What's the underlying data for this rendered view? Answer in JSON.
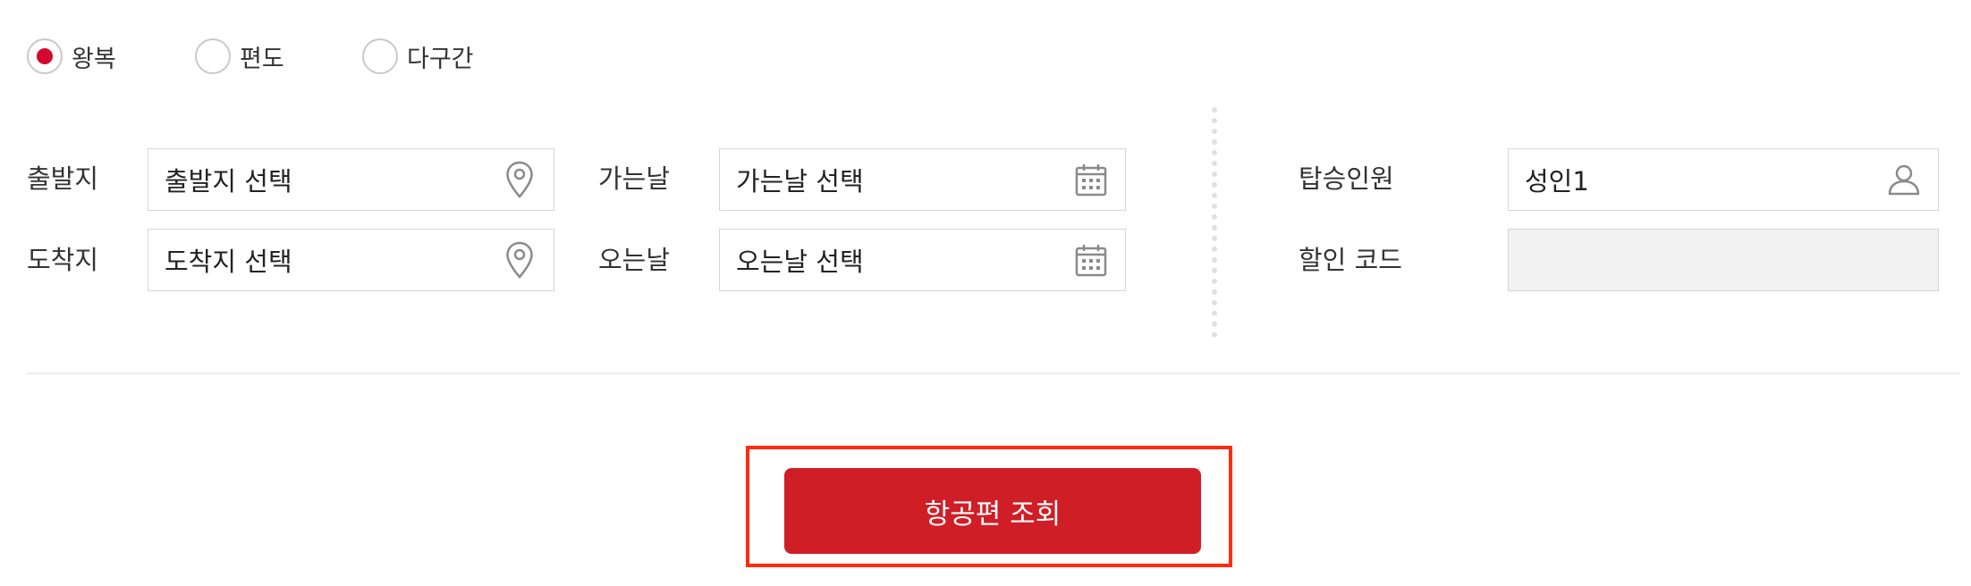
{
  "trip_type": {
    "options": [
      {
        "label": "왕복",
        "selected": true
      },
      {
        "label": "편도",
        "selected": false
      },
      {
        "label": "다구간",
        "selected": false
      }
    ]
  },
  "departure": {
    "label": "출발지",
    "value": "출발지 선택",
    "icon": "map-pin-icon"
  },
  "arrival": {
    "label": "도착지",
    "value": "도착지 선택",
    "icon": "map-pin-icon"
  },
  "depart_date": {
    "label": "가는날",
    "value": "가는날 선택",
    "icon": "calendar-icon"
  },
  "return_date": {
    "label": "오는날",
    "value": "오는날 선택",
    "icon": "calendar-icon"
  },
  "passengers": {
    "label": "탑승인원",
    "value": "성인1",
    "icon": "person-icon"
  },
  "discount_code": {
    "label": "할인 코드",
    "value": "",
    "disabled": true
  },
  "search_button": {
    "label": "항공편 조회",
    "color": "#d01e26"
  },
  "colors": {
    "accent": "#d5072e",
    "highlight_box": "#ff2c0f"
  }
}
